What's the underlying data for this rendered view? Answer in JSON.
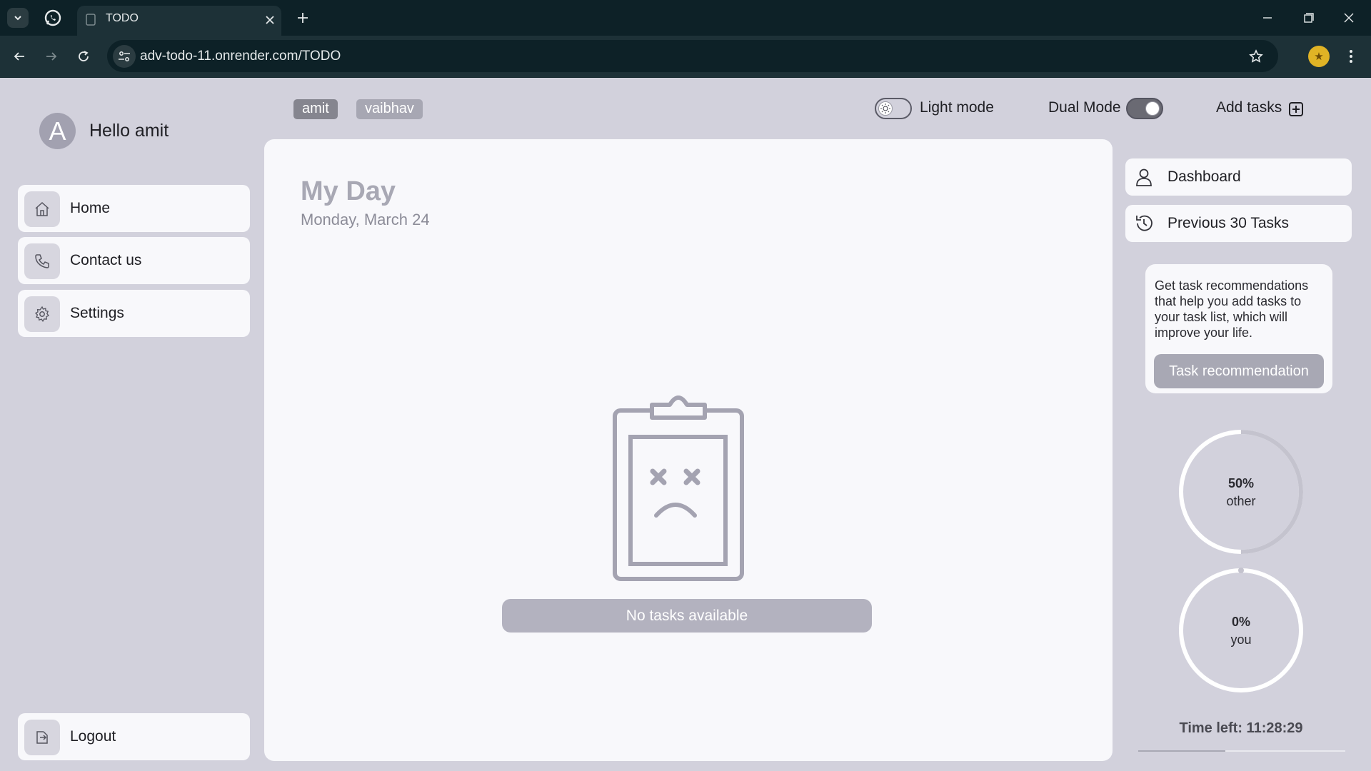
{
  "browser": {
    "tab_title": "TODO",
    "url": "adv-todo-11.onrender.com/TODO"
  },
  "sidebar": {
    "avatar_letter": "A",
    "greeting": "Hello amit",
    "items": [
      {
        "label": "Home",
        "icon": "home-icon"
      },
      {
        "label": "Contact us",
        "icon": "phone-icon"
      },
      {
        "label": "Settings",
        "icon": "gear-icon"
      }
    ],
    "logout_label": "Logout"
  },
  "topbar": {
    "users": [
      "amit",
      "vaibhav"
    ],
    "light_mode_label": "Light mode",
    "dual_mode_label": "Dual Mode",
    "add_tasks_label": "Add tasks"
  },
  "main": {
    "title": "My Day",
    "date": "Monday, March 24",
    "empty_label": "No tasks available"
  },
  "right": {
    "dashboard_label": "Dashboard",
    "previous_label": "Previous 30 Tasks",
    "recommendation_text": "Get task recommendations that help you add tasks to your task list, which will improve your life.",
    "recommendation_button": "Task recommendation",
    "progress": [
      {
        "percent_label": "50%",
        "label": "other",
        "value": 0.5
      },
      {
        "percent_label": "0%",
        "label": "you",
        "value": 0
      }
    ],
    "time_left": "Time left: 11:28:29",
    "time_left_fraction": 0.42
  },
  "colors": {
    "chrome_dark": "#0d2127",
    "app_background": "#d2d1dc",
    "panel": "#f8f8fb",
    "accent_gray": "#a8a8b4"
  }
}
